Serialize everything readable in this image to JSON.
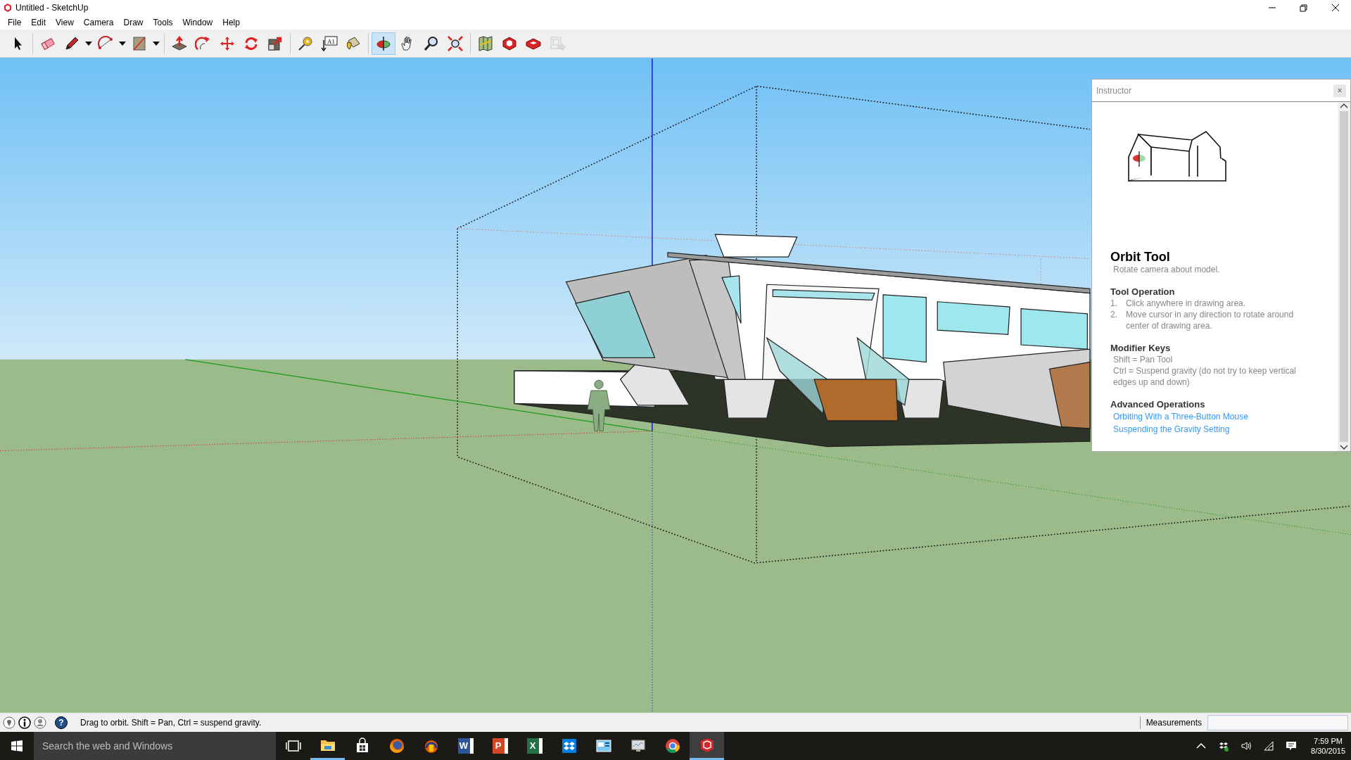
{
  "window": {
    "title": "Untitled - SketchUp"
  },
  "menu": [
    {
      "label": "File"
    },
    {
      "label": "Edit"
    },
    {
      "label": "View"
    },
    {
      "label": "Camera"
    },
    {
      "label": "Draw"
    },
    {
      "label": "Tools"
    },
    {
      "label": "Window"
    },
    {
      "label": "Help"
    }
  ],
  "toolbar": [
    {
      "kind": "select",
      "selected": false,
      "disabled": false
    },
    {
      "kind": "eraser",
      "selected": false,
      "disabled": false,
      "separator_before": true
    },
    {
      "kind": "pencil",
      "selected": false,
      "disabled": false,
      "dropdown": true
    },
    {
      "kind": "arc",
      "selected": false,
      "disabled": false,
      "dropdown": true
    },
    {
      "kind": "rectangle",
      "selected": false,
      "disabled": false,
      "dropdown": true
    },
    {
      "kind": "pushpull",
      "selected": false,
      "disabled": false,
      "separator_before": true
    },
    {
      "kind": "followme",
      "selected": false,
      "disabled": false
    },
    {
      "kind": "move",
      "selected": false,
      "disabled": false
    },
    {
      "kind": "rotate",
      "selected": false,
      "disabled": false
    },
    {
      "kind": "scale",
      "selected": false,
      "disabled": false
    },
    {
      "kind": "tape",
      "selected": false,
      "disabled": false,
      "separator_before": true
    },
    {
      "kind": "text",
      "selected": false,
      "disabled": false,
      "label": "A1"
    },
    {
      "kind": "paint",
      "selected": false,
      "disabled": false
    },
    {
      "kind": "orbit",
      "selected": true,
      "disabled": false,
      "separator_before": true
    },
    {
      "kind": "pan",
      "selected": false,
      "disabled": false
    },
    {
      "kind": "zoom",
      "selected": false,
      "disabled": false
    },
    {
      "kind": "extents",
      "selected": false,
      "disabled": false
    },
    {
      "kind": "map",
      "selected": false,
      "disabled": false,
      "separator_before": true
    },
    {
      "kind": "warehouse",
      "selected": false,
      "disabled": false
    },
    {
      "kind": "extension",
      "selected": false,
      "disabled": false
    },
    {
      "kind": "layout",
      "selected": false,
      "disabled": true
    }
  ],
  "instructor": {
    "title": "Instructor",
    "close": "×",
    "tool_name": "Orbit Tool",
    "description": "Rotate camera about model.",
    "sections": [
      {
        "heading": "Tool Operation",
        "kind": "numbered",
        "items": [
          {
            "number": "1.",
            "text": "Click anywhere in drawing area."
          },
          {
            "number": "2.",
            "text": "Move cursor in any direction to rotate around center of drawing area."
          }
        ]
      },
      {
        "heading": "Modifier Keys",
        "kind": "plain",
        "items": [
          {
            "text": "Shift = Pan Tool"
          },
          {
            "text": "Ctrl = Suspend gravity (do not try to keep vertical edges up and down)"
          }
        ]
      },
      {
        "heading": "Advanced Operations",
        "kind": "links",
        "items": [
          {
            "text": "Orbiting With a Three-Button Mouse"
          },
          {
            "text": "Suspending the Gravity Setting"
          }
        ]
      }
    ]
  },
  "status_bar": {
    "icons": [
      {
        "kind": "location"
      },
      {
        "kind": "info"
      },
      {
        "kind": "user"
      },
      {
        "kind": "help",
        "glyph": "?"
      }
    ],
    "hint": "Drag to orbit. Shift = Pan, Ctrl = suspend gravity.",
    "measurements_label": "Measurements"
  },
  "taskbar": {
    "search_placeholder": "Search the web and Windows",
    "apps": [
      {
        "kind": "taskview",
        "running": false,
        "selected": false
      },
      {
        "kind": "explorer",
        "running": true,
        "selected": false
      },
      {
        "kind": "store",
        "running": false,
        "selected": false
      },
      {
        "kind": "firefox",
        "running": false,
        "selected": false
      },
      {
        "kind": "audio",
        "running": false,
        "selected": false
      },
      {
        "kind": "word",
        "glyph": "W",
        "running": false,
        "selected": false
      },
      {
        "kind": "powerpoint",
        "glyph": "P",
        "running": false,
        "selected": false
      },
      {
        "kind": "excel",
        "glyph": "X",
        "running": false,
        "selected": false
      },
      {
        "kind": "dropbox",
        "running": false,
        "selected": false
      },
      {
        "kind": "panel",
        "running": false,
        "selected": false
      },
      {
        "kind": "monitor",
        "running": false,
        "selected": false
      },
      {
        "kind": "chrome",
        "running": false,
        "selected": false
      },
      {
        "kind": "sketchup",
        "running": true,
        "selected": true
      }
    ],
    "time": "7:59 PM",
    "date": "8/30/2015"
  }
}
